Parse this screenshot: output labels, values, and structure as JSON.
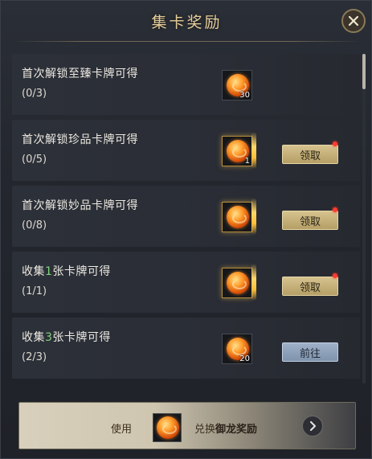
{
  "header": {
    "title": "集卡奖励"
  },
  "rows": [
    {
      "title": "首次解锁至臻卡牌可得",
      "progress": "(0/3)",
      "reward_qty": "30",
      "button": "",
      "has_dot": false
    },
    {
      "title": "首次解锁珍品卡牌可得",
      "progress": "(0/5)",
      "reward_qty": "1",
      "button": "领取",
      "has_dot": true
    },
    {
      "title": "首次解锁妙品卡牌可得",
      "progress": "(0/8)",
      "reward_qty": "",
      "button": "领取",
      "has_dot": true
    },
    {
      "title_pre": "收集",
      "title_num": "1",
      "title_post": "张卡牌可得",
      "progress": "(1/1)",
      "reward_qty": "",
      "button": "领取",
      "has_dot": true
    },
    {
      "title_pre": "收集",
      "title_num": "3",
      "title_post": "张卡牌可得",
      "progress": "(2/3)",
      "reward_qty": "20",
      "button": "前往",
      "has_dot": false
    }
  ],
  "footer": {
    "use_label": "使用",
    "exchange_prefix": "兑换",
    "exchange_target": "御龙奖励"
  },
  "icons": {
    "close": "close-icon",
    "reward": "fire-orb-icon",
    "next": "chevron-right-icon"
  },
  "colors": {
    "title": "#e7cf9a",
    "claim_button": "#c9b57e",
    "goto_button": "#8fa2bb",
    "highlight_number": "#7fd47a",
    "notify_dot": "#ff3b2f"
  }
}
